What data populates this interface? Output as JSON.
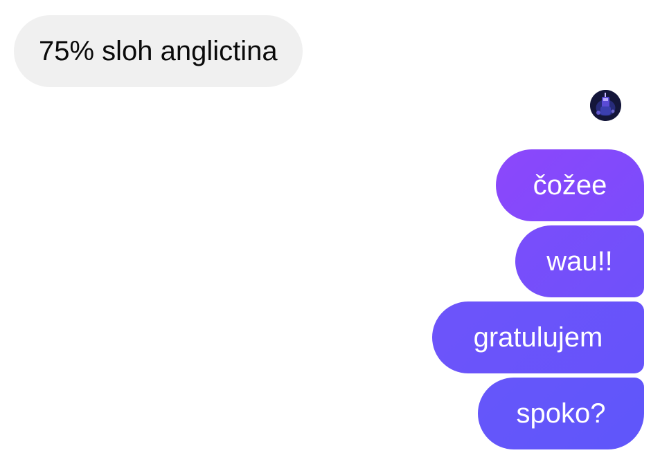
{
  "conversation": {
    "incoming": [
      {
        "text": "75% sloh anglictina"
      }
    ],
    "outgoing": [
      {
        "text": "čožee"
      },
      {
        "text": "wau!!"
      },
      {
        "text": "gratulujem"
      },
      {
        "text": "spoko?"
      }
    ]
  },
  "avatar": {
    "icon": "contact-avatar-icon"
  },
  "colors": {
    "incoming_bubble": "#f0f0f0",
    "incoming_text": "#0a0a0a",
    "outgoing_gradient_top": "#8c47fb",
    "outgoing_gradient_bottom": "#5f56fa",
    "outgoing_text": "#ffffff"
  }
}
